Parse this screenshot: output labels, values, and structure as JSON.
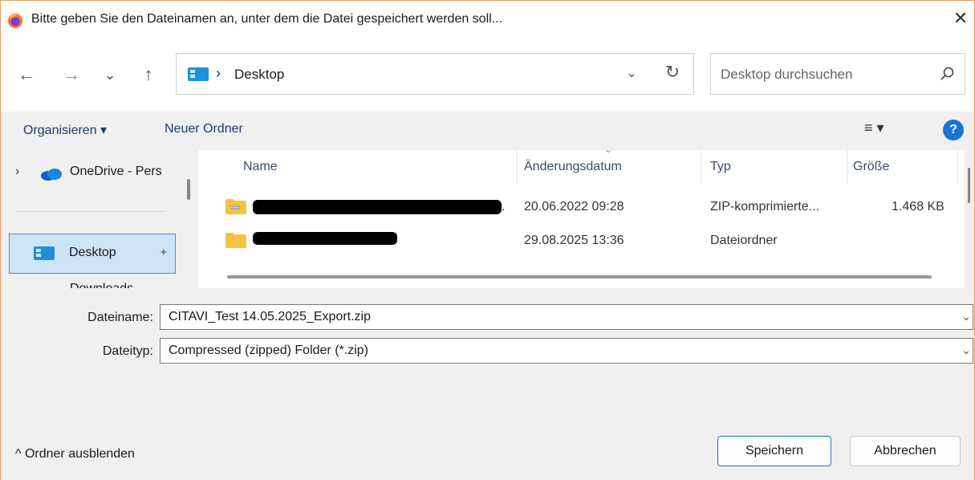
{
  "window": {
    "title": "Bitte geben Sie den Dateinamen an, unter dem die Datei gespeichert werden soll...",
    "close_glyph": "✕"
  },
  "nav": {
    "back_glyph": "←",
    "forward_glyph": "→",
    "recent_glyph": "⌄",
    "up_glyph": "↑",
    "address_separator": "›",
    "address_location": "Desktop",
    "address_dropdown_glyph": "⌄",
    "refresh_glyph": "↻",
    "search_placeholder": "Desktop durchsuchen"
  },
  "toolbar": {
    "organize_label": "Organisieren ▾",
    "new_folder_label": "Neuer Ordner",
    "view_label": "≡ ▾",
    "help_label": "?"
  },
  "navpane": {
    "onedrive_chevron": "›",
    "onedrive_label": "OneDrive - Pers",
    "desktop_label": "Desktop",
    "pin_glyph": "📌",
    "downloads_label": "Downloads"
  },
  "filelist": {
    "columns": {
      "name": "Name",
      "date": "Änderungsdatum",
      "type": "Typ",
      "size": "Größe"
    },
    "sort_glyph": "⌄",
    "rows": [
      {
        "date": "20.06.2022 09:28",
        "type": "ZIP-komprimierte...",
        "size": "1.468 KB",
        "name_suffix": "."
      },
      {
        "date": "29.08.2025 13:36",
        "type": "Dateiordner",
        "size": ""
      }
    ]
  },
  "form": {
    "filename_label": "Dateiname:",
    "filename_value": "CITAVI_Test 14.05.2025_Export.zip",
    "filetype_label": "Dateityp:",
    "filetype_value": "Compressed (zipped) Folder (*.zip)",
    "chevron": "⌄"
  },
  "footer": {
    "hide_folders_label": "^  Ordner ausblenden",
    "save_label": "Speichern",
    "cancel_label": "Abbrechen"
  },
  "colors": {
    "accent": "#1a73d6",
    "selection": "#cde4f7",
    "window_border": "#e8a060"
  }
}
